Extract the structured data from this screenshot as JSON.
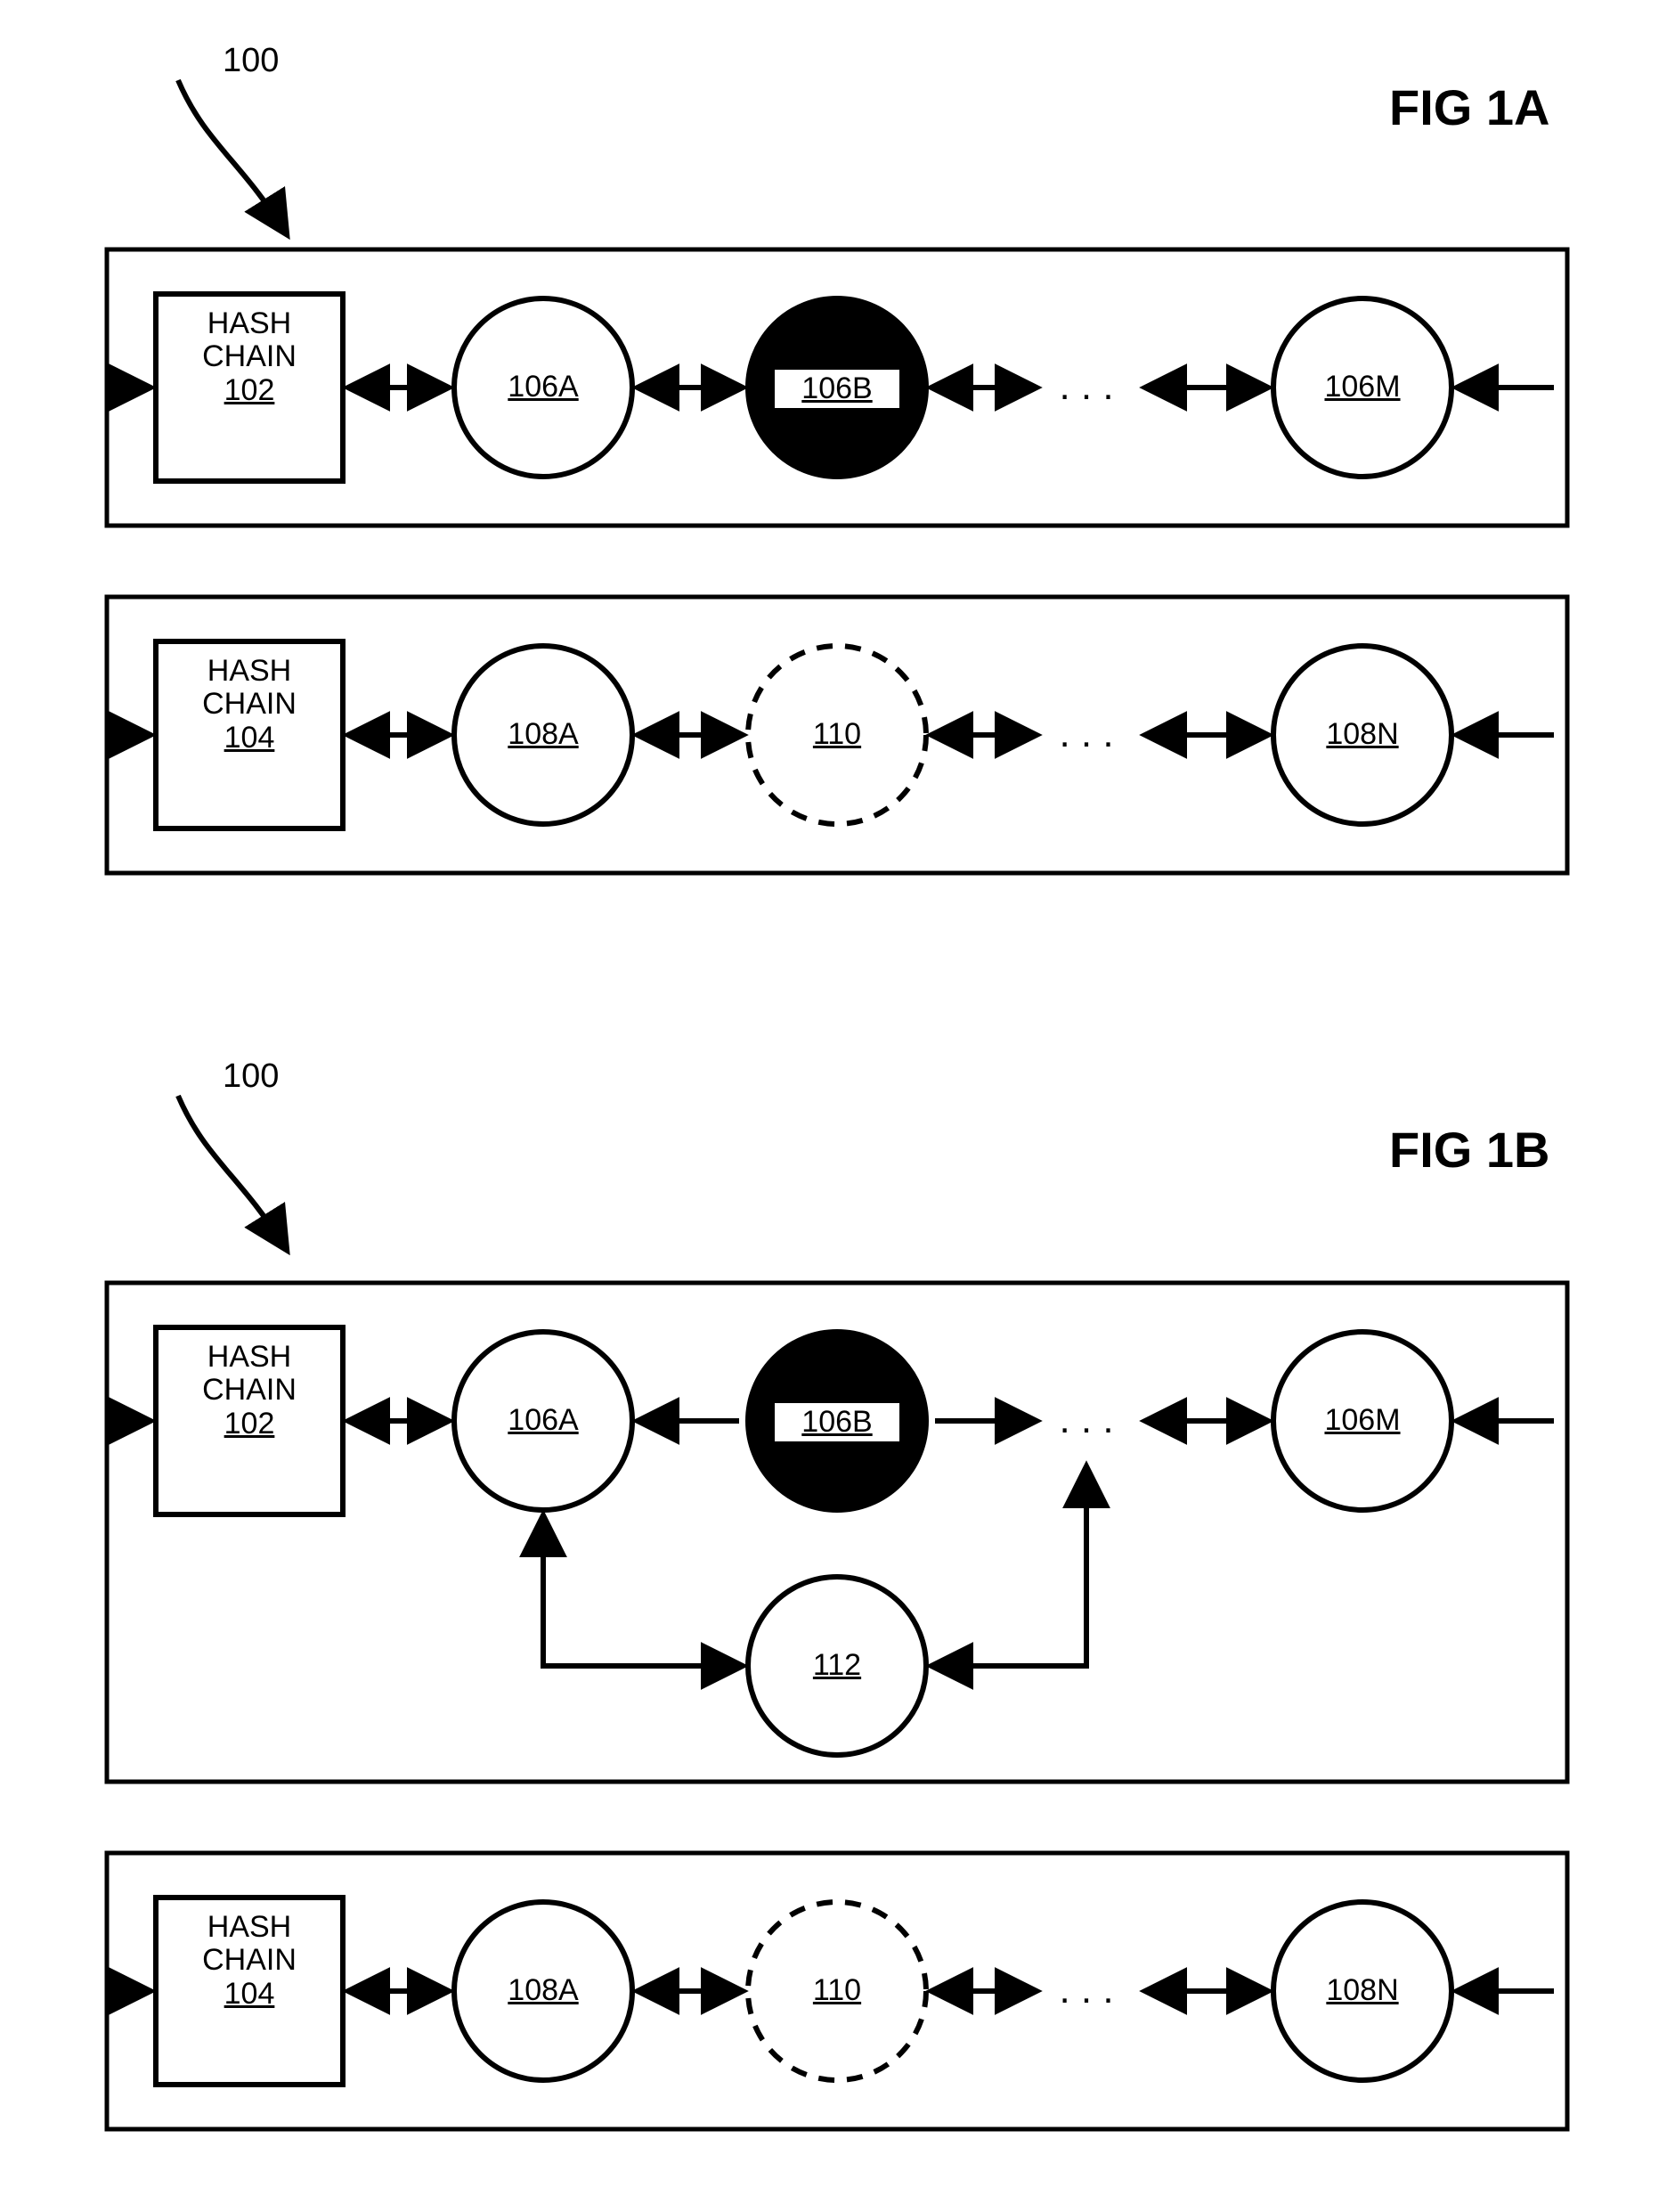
{
  "figA": {
    "title": "FIG 1A",
    "callout": "100",
    "chain1": {
      "hash_label_line1": "HASH",
      "hash_label_line2": "CHAIN",
      "hash_ref": "102",
      "nodeA": "106A",
      "nodeB": "106B",
      "ellipsis": ". . .",
      "nodeM": "106M"
    },
    "chain2": {
      "hash_label_line1": "HASH",
      "hash_label_line2": "CHAIN",
      "hash_ref": "104",
      "nodeA": "108A",
      "nodeDashed": "110",
      "ellipsis": ". . .",
      "nodeN": "108N"
    }
  },
  "figB": {
    "title": "FIG 1B",
    "callout": "100",
    "chain1": {
      "hash_label_line1": "HASH",
      "hash_label_line2": "CHAIN",
      "hash_ref": "102",
      "nodeA": "106A",
      "nodeB": "106B",
      "ellipsis": ". . .",
      "nodeM": "106M",
      "nodeNew": "112"
    },
    "chain2": {
      "hash_label_line1": "HASH",
      "hash_label_line2": "CHAIN",
      "hash_ref": "104",
      "nodeA": "108A",
      "nodeDashed": "110",
      "ellipsis": ". . .",
      "nodeN": "108N"
    }
  }
}
